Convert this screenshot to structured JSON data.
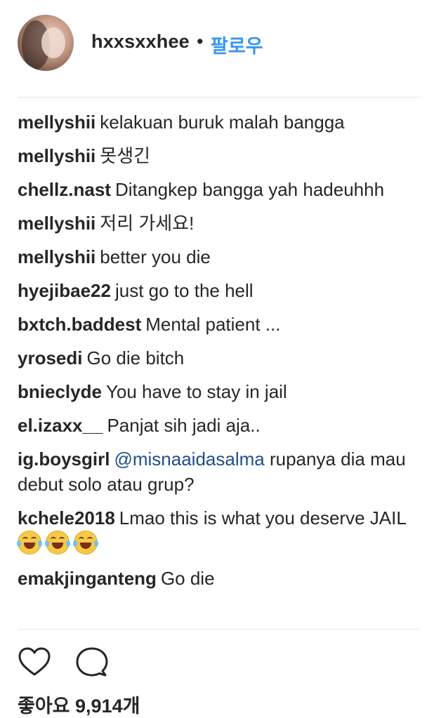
{
  "post_header": {
    "username": "hxxsxxhee",
    "separator": "•",
    "follow_label": "팔로우"
  },
  "comments": [
    {
      "user": "mellyshii",
      "text": "kelakuan buruk malah bangga"
    },
    {
      "user": "mellyshii",
      "text": "못생긴"
    },
    {
      "user": "chellz.nast",
      "text": "Ditangkep bangga yah hadeuhhh"
    },
    {
      "user": "mellyshii",
      "text": "저리 가세요!"
    },
    {
      "user": "mellyshii",
      "text": "better you die"
    },
    {
      "user": "hyejibae22",
      "text": "just go to the hell"
    },
    {
      "user": "bxtch.baddest",
      "text": "Mental patient ..."
    },
    {
      "user": "yrosedi",
      "text": "Go die bitch"
    },
    {
      "user": "bnieclyde",
      "text": "You have to stay in jail"
    },
    {
      "user": "el.izaxx__",
      "text": "Panjat sih jadi aja.."
    },
    {
      "user": "ig.boysgirl",
      "mention": "@misnaaidasalma",
      "text": "rupanya dia mau debut solo atau grup?"
    },
    {
      "user": "kchele2018",
      "text": "Lmao this is what you deserve JAIL"
    },
    {
      "user": "emakjinganteng",
      "text": "Go die"
    }
  ],
  "emoji_names": [
    "face-with-tears-of-joy",
    "face-with-tears-of-joy",
    "face-with-tears-of-joy"
  ],
  "actions": {
    "like_icon": "heart-icon",
    "comment_icon": "comment-bubble-icon"
  },
  "likes_text": "좋아요 9,914개",
  "colors": {
    "text": "#262626",
    "follow_blue": "#3897f0",
    "mention_blue": "#1f4e89",
    "divider": "#e6e6e6"
  }
}
